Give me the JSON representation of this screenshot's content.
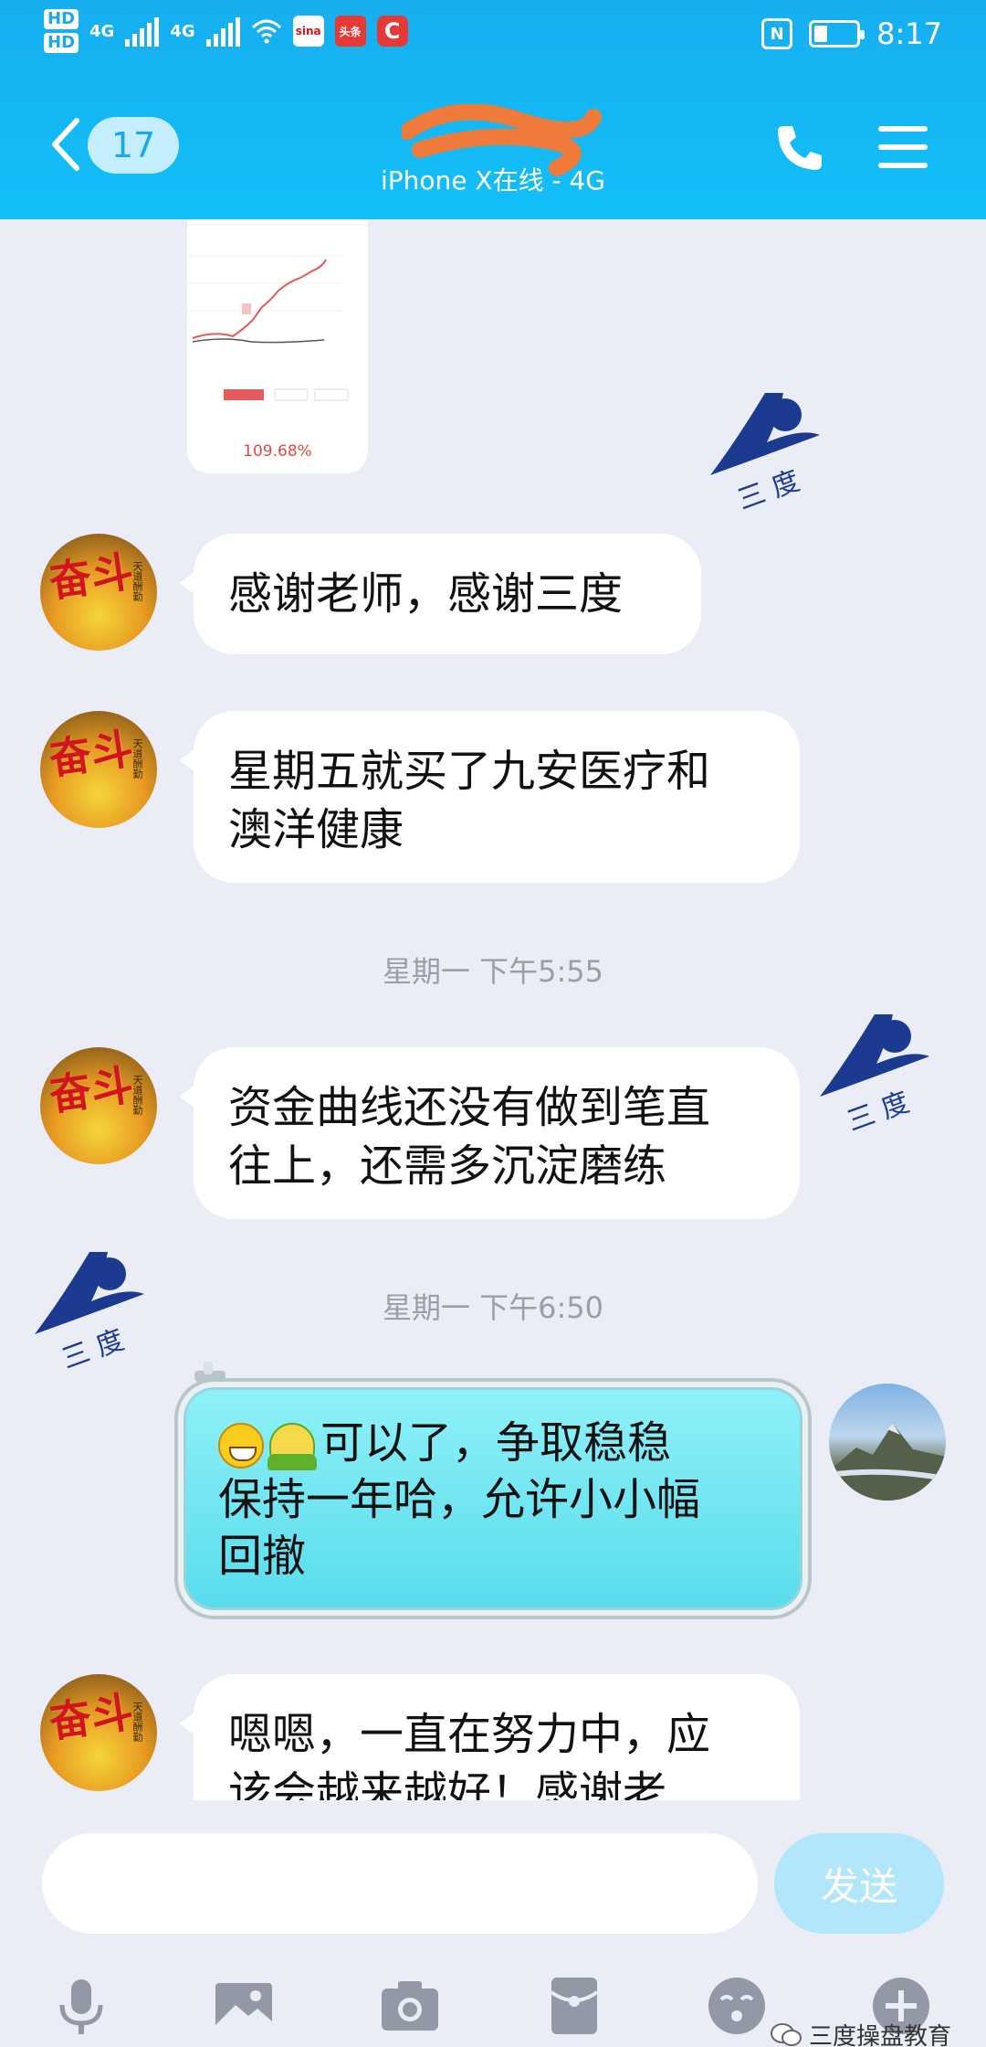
{
  "status_bar": {
    "hd1": "HD",
    "hd2": "HD",
    "net1": "4G",
    "net2": "4G",
    "app1": "sina",
    "app2": "头条",
    "app3": "C",
    "nfc": "N",
    "time": "8:17"
  },
  "header": {
    "unread_count": "17",
    "subtitle": "iPhone X在线 - 4G"
  },
  "shared_image": {
    "percent": "109.68%"
  },
  "messages": [
    {
      "side": "left",
      "text": "感谢老师，感谢三度"
    },
    {
      "side": "left",
      "text_lines": [
        "星期五就买了九安医疗和",
        "澳洋健康"
      ]
    },
    {
      "side": "left",
      "text_lines": [
        "资金曲线还没有做到笔直",
        "往上，还需多沉淀磨练"
      ]
    },
    {
      "side": "right",
      "text_lines": [
        "可以了，争取稳稳",
        "保持一年哈，允许小小幅",
        "回撤"
      ]
    },
    {
      "side": "left",
      "text_lines": [
        "嗯嗯，一直在努力中，应",
        "该会越来越好！感谢老"
      ]
    }
  ],
  "timestamps": [
    "星期一 下午5:55",
    "星期一 下午6:50"
  ],
  "avatar_left_text": "奋斗",
  "avatar_left_small": "天道酬勤",
  "logo_text": "三 度",
  "input": {
    "placeholder": "",
    "send_label": "发送"
  },
  "toolbar_icons": [
    "mic-icon",
    "image-icon",
    "camera-icon",
    "red-packet-icon",
    "emoji-icon",
    "plus-icon"
  ],
  "watermark": "三度操盘教育",
  "colors": {
    "header_blue": "#17aef0",
    "background": "#eaedf5",
    "send_button": "#b1e6fb",
    "fancy_bubble": "#6be3f1"
  }
}
